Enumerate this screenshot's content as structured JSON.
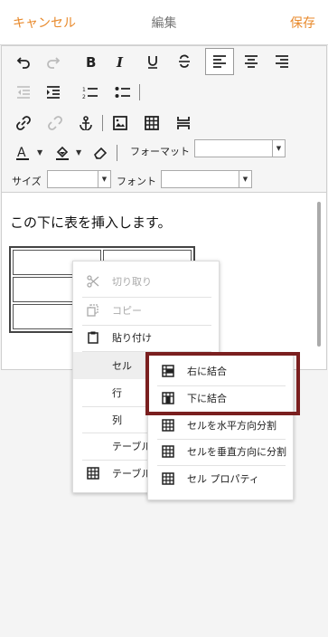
{
  "header": {
    "cancel_label": "キャンセル",
    "title": "編集",
    "save_label": "保存"
  },
  "toolbar": {
    "format_label": "フォーマット",
    "format_value": "",
    "size_label": "サイズ",
    "size_value": "",
    "font_label": "フォント",
    "font_value": ""
  },
  "content": {
    "paragraph": "この下に表を挿入します。"
  },
  "context_menu": {
    "items": [
      {
        "label": "切り取り",
        "icon": "scissors-icon",
        "disabled": true
      },
      {
        "label": "コピー",
        "icon": "copy-icon",
        "disabled": true
      },
      {
        "label": "貼り付け",
        "icon": "paste-icon",
        "disabled": false
      },
      {
        "label": "セル",
        "icon": "",
        "disabled": false
      },
      {
        "label": "行",
        "icon": "",
        "disabled": false
      },
      {
        "label": "列",
        "icon": "",
        "disabled": false
      },
      {
        "label": "テーブル",
        "icon": "",
        "disabled": false
      },
      {
        "label": "テーブル",
        "icon": "table-icon",
        "disabled": false
      }
    ]
  },
  "submenu": {
    "items": [
      {
        "label": "右に結合",
        "icon": "merge-right-icon"
      },
      {
        "label": "下に結合",
        "icon": "merge-down-icon"
      },
      {
        "label": "セルを水平方向分割",
        "icon": "split-horizontal-icon"
      },
      {
        "label": "セルを垂直方向に分割",
        "icon": "split-vertical-icon"
      },
      {
        "label": "セル プロパティ",
        "icon": "cell-properties-icon"
      }
    ]
  },
  "colors": {
    "accent": "#e8892b",
    "callout": "#7a1f1f"
  }
}
